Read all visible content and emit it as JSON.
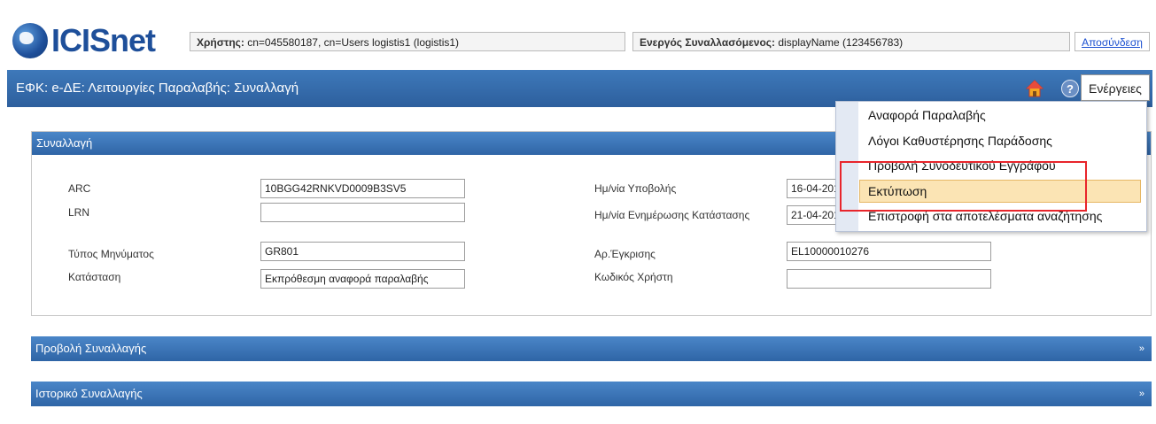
{
  "header": {
    "logo_text": "ICISnet",
    "user_label": "Χρήστης:",
    "user_value": "cn=045580187, cn=Users logistis1 (logistis1)",
    "trader_label": "Ενεργός Συναλλασόμενος:",
    "trader_value": "displayName (123456783)",
    "logout": "Αποσύνδεση"
  },
  "titlebar": {
    "title": "ΕΦΚ: e-ΔΕ: Λειτουργίες Παραλαβής: Συναλλαγή",
    "help_glyph": "?",
    "actions_label": "Ενέργειες"
  },
  "section": {
    "title": "Συναλλαγή",
    "left_fields": [
      {
        "label": "ARC",
        "value": "10BGG42RNKVD0009B3SV5"
      },
      {
        "label": "LRN",
        "value": ""
      },
      {
        "label": "Τύπος Μηνύματος",
        "value": "GR801"
      },
      {
        "label": "Κατάσταση",
        "value": "Εκπρόθεσμη αναφορά παραλαβής"
      }
    ],
    "right_fields": [
      {
        "label": "Ημ/νία Υποβολής",
        "value": "16-04-201"
      },
      {
        "label": "Ημ/νία Ενημέρωσης Κατάστασης",
        "value": "21-04-201"
      },
      {
        "label": "Αρ.Έγκρισης",
        "value": "EL10000010276"
      },
      {
        "label": "Κωδικός Χρήστη",
        "value": ""
      }
    ]
  },
  "collapsed_sections": [
    {
      "title": "Προβολή Συναλλαγής",
      "chevron": "»"
    },
    {
      "title": "Ιστορικό Συναλλαγής",
      "chevron": "»"
    }
  ],
  "actions_menu": {
    "items": [
      "Αναφορά Παραλαβής",
      "Λόγοι Καθυστέρησης Παράδοσης",
      "Προβολή Συνοδευτικού Εγγράφου",
      "Εκτύπωση",
      "Επιστροφή στα αποτελέσματα αναζήτησης"
    ],
    "highlighted_index": 3
  },
  "icons": [
    "globe-logo-icon",
    "home-icon",
    "help-icon",
    "chevron-right-icon"
  ],
  "colors": {
    "title_bar": "#2d5f9d",
    "section_header": "#3a74b6",
    "highlight": "#fbe4b4",
    "annotation": "#e8252b",
    "link": "#1a4fd0"
  }
}
